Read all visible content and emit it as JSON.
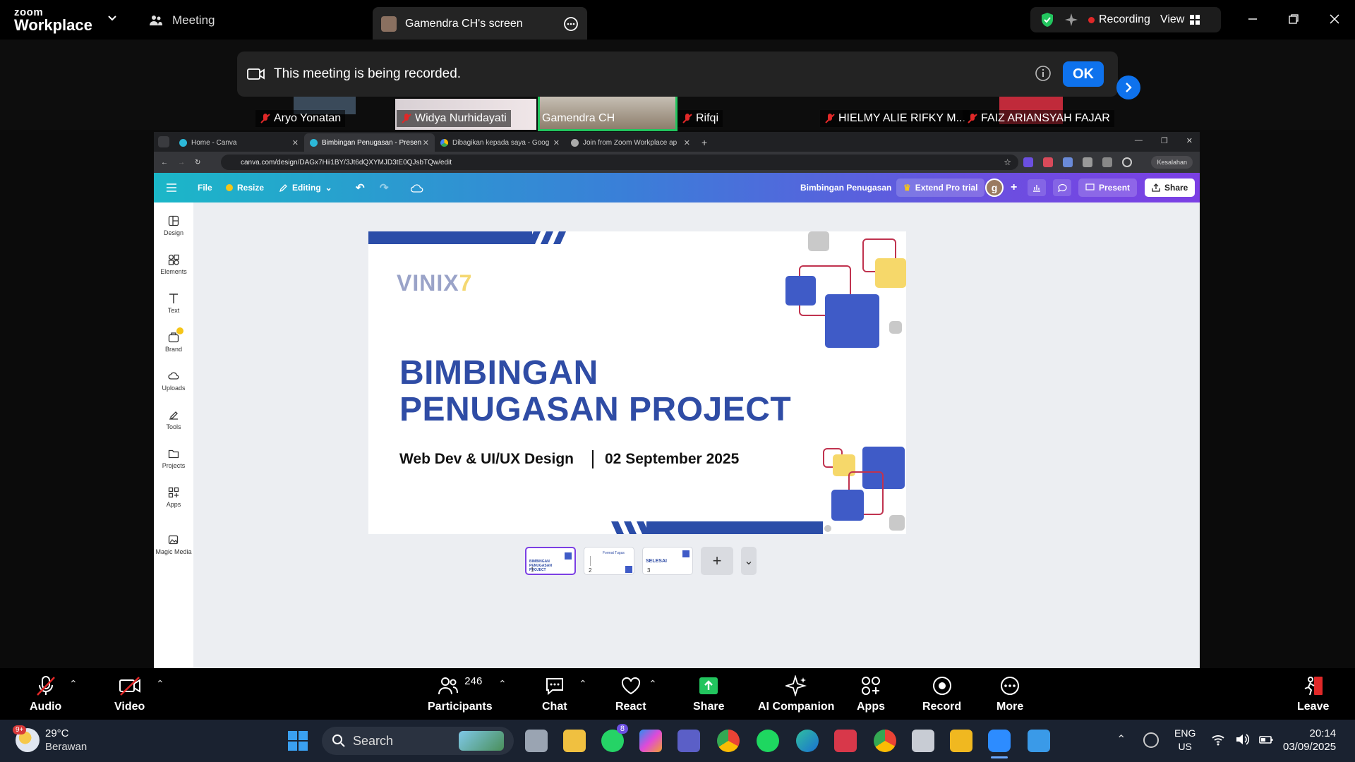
{
  "zoom": {
    "logo_top": "zoom",
    "logo_bottom": "Workplace",
    "meeting_tab": "Meeting",
    "screen_tab": "Gamendra CH's screen",
    "recording": "Recording",
    "view": "View",
    "banner": "This meeting is being recorded.",
    "ok": "OK",
    "participants": [
      {
        "name": "Aryo Yonatan"
      },
      {
        "name": "Widya Nurhidayati"
      },
      {
        "name": "Gamendra CH"
      },
      {
        "name": "Rifqi"
      },
      {
        "name": "HIELMY ALIE RIFKY M..."
      },
      {
        "name": "FAIZ ARIANSYAH FAJAR"
      }
    ]
  },
  "browser": {
    "tabs": [
      {
        "label": "Home - Canva",
        "icon": "canva-icon"
      },
      {
        "label": "Bimbingan Penugasan - Presen",
        "icon": "canva-icon"
      },
      {
        "label": "Dibagikan kepada saya - Goog",
        "icon": "drive-icon"
      },
      {
        "label": "Join from Zoom Workplace ap",
        "icon": "zoom-icon"
      }
    ],
    "url": "canva.com/design/DAGx7Hii1BY/3Jt6dQXYMJD3tE0QJsbTQw/edit",
    "profile_label": "Kesalahan"
  },
  "canva": {
    "file": "File",
    "resize": "Resize",
    "editing": "Editing",
    "doc_title": "Bimbingan Penugasan",
    "extend_pro": "Extend Pro trial",
    "avatar_letter": "g",
    "present": "Present",
    "share": "Share",
    "sidebar": [
      "Design",
      "Elements",
      "Text",
      "Brand",
      "Uploads",
      "Tools",
      "Projects",
      "Apps",
      "Magic Media"
    ],
    "slide": {
      "brand": "VINIX",
      "brand_accent": "7",
      "title_line1": "BIMBINGAN",
      "title_line2": "PENUGASAN PROJECT",
      "subtitle_left": "Web Dev & UI/UX Design",
      "subtitle_right": "02 September 2025"
    },
    "pages": [
      {
        "number": "1",
        "text": "BIMBINGAN PENUGASAN PROJECT"
      },
      {
        "number": "2",
        "text": "Format Tugas"
      },
      {
        "number": "3",
        "text": "SELESAI"
      }
    ]
  },
  "toolbar": {
    "audio": "Audio",
    "video": "Video",
    "participants": "Participants",
    "participants_count": "246",
    "chat": "Chat",
    "react": "React",
    "share": "Share",
    "ai_companion": "AI Companion",
    "apps": "Apps",
    "record": "Record",
    "more": "More",
    "leave": "Leave"
  },
  "taskbar": {
    "weather_temp": "29°C",
    "weather_desc": "Berawan",
    "weather_badge": "9+",
    "search": "Search",
    "whatsapp_badge": "8",
    "lang_top": "ENG",
    "lang_bottom": "US",
    "time": "20:14",
    "date": "03/09/2025"
  }
}
